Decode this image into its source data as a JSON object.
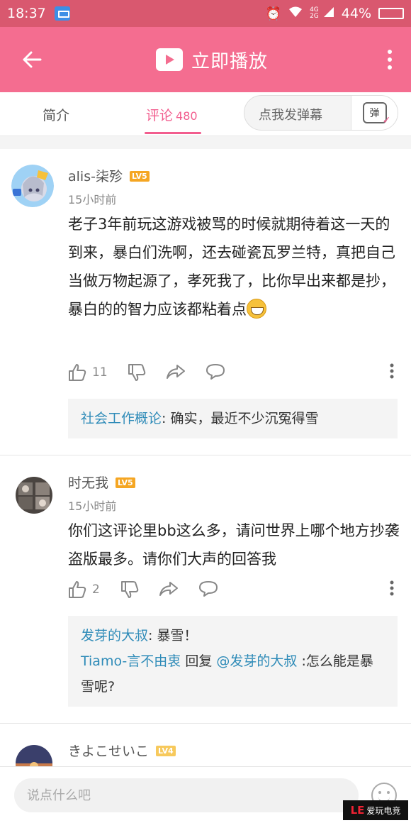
{
  "status_bar": {
    "time": "18:37",
    "network": "4G",
    "network2": "2G",
    "battery": "44%",
    "battery_level": 0.44
  },
  "app_bar": {
    "title": "立即播放"
  },
  "tabs": {
    "intro": "简介",
    "comments": "评论",
    "comments_count": "480",
    "danmaku_placeholder": "点我发弹幕",
    "danmaku_button": "弹"
  },
  "comments": [
    {
      "username": "alis-柒殄",
      "level": "LV5",
      "time": "15小时前",
      "text": "老子3年前玩这游戏被骂的时候就期待着这一天的到来，暴白们洗啊，还去碰瓷瓦罗兰特，真把自己当做万物起源了，孝死我了，比你早出来都是抄，暴白的的智力应该都粘着点",
      "likes": "11",
      "replies": [
        {
          "name": "社会工作概论",
          "sep": ": ",
          "text": "确实，最近不少沉冤得雪"
        }
      ]
    },
    {
      "username": "时无我",
      "level": "LV5",
      "time": "15小时前",
      "text": "你们这评论里bb这么多，请问世界上哪个地方抄袭盗版最多。请你们大声的回答我",
      "likes": "2",
      "replies": [
        {
          "name": "发芽的大叔",
          "sep": ": ",
          "text": "暴雪！"
        },
        {
          "name": "Tiamo-言不由衷",
          "mid": " 回复 ",
          "target": "@发芽的大叔",
          "text": " :怎么能是暴雪呢?"
        }
      ]
    },
    {
      "username": "きよこせいこ",
      "level": "LV4"
    }
  ],
  "input": {
    "placeholder": "说点什么吧"
  },
  "watermark": {
    "logo": "LE",
    "text": "爱玩电竞"
  }
}
